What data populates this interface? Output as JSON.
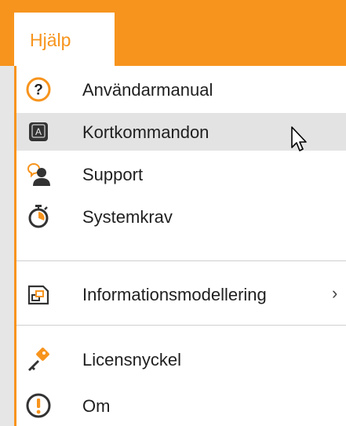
{
  "menubar": {
    "active_tab": "Hjälp"
  },
  "menu": {
    "items": [
      {
        "label": "Användarmanual",
        "icon": "help-circle-icon"
      },
      {
        "label": "Kortkommandon",
        "icon": "keyboard-key-icon",
        "hovered": true
      },
      {
        "label": "Support",
        "icon": "support-person-icon"
      },
      {
        "label": "Systemkrav",
        "icon": "stopwatch-icon"
      },
      {
        "label": "Informationsmodellering",
        "icon": "model-window-icon",
        "has_submenu": true,
        "submenu_glyph": "›"
      },
      {
        "label": "Licensnyckel",
        "icon": "license-key-icon"
      },
      {
        "label": "Om",
        "icon": "about-info-icon"
      }
    ]
  },
  "colors": {
    "accent": "#f7941d",
    "hover_bg": "#e3e3e3",
    "text": "#1f1f1f"
  }
}
